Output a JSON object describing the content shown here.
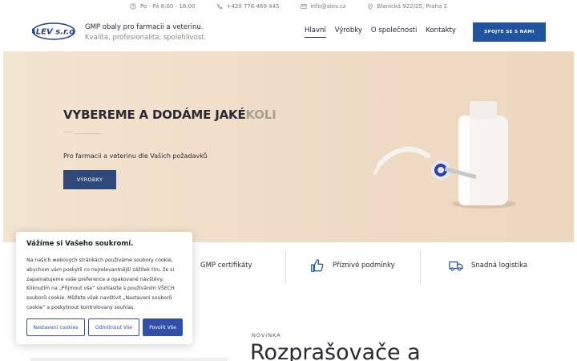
{
  "topbar": {
    "hours": "Po - Pá 8:00 - 18:00",
    "phone": "+420 776 469 445",
    "email": "info@alev.cz",
    "address": "Blanická 922/25, Praha 2"
  },
  "header": {
    "logo_text": "ALEV s.r.o.",
    "tagline_line1": "GMP obaly pro farmacii a veterinu.",
    "tagline_line2": "Kvalita, profesionalita, spolehlivost.",
    "nav": [
      "Hlavní",
      "Výrobky",
      "O společnosti",
      "Kontakty"
    ],
    "cta": "SPOJTE SE S NÁMI"
  },
  "hero": {
    "title_main": "VYBEREME A DODÁME JAKÉ",
    "title_fade": "KOLI",
    "subtitle": "Pro farmacii a veterinu dle Vašich požadavků",
    "button": "VÝROBKY"
  },
  "features": [
    "GMP certifikáty",
    "Příznivé podmínky",
    "Snadná logistika"
  ],
  "section": {
    "label": "NOVINKA",
    "heading": "Rozprašovače a"
  },
  "cookie": {
    "title": "Vážíme si Vašeho soukromí.",
    "text": "Na našich webových stránkách používáme soubory cookie, abychom vám poskytli co nejrelevantnější zážitek tím, že si zapamatujeme vaše preference a opakované návštěvy. Kliknutím na „Přijmout vše“ souhlasíte s používáním VŠECH souborů cookie. Můžete však navštívit „Nastavení souborů cookie“ a poskytnout kontrolovaný souhlas.",
    "btn_settings": "Nastavení cookies",
    "btn_reject": "Odmítnout Vše",
    "btn_accept": "Povolit Vše"
  },
  "colors": {
    "brand_blue": "#2054a0",
    "hero_button": "#2f4a7a",
    "cookie_blue": "#2f4fa8"
  }
}
